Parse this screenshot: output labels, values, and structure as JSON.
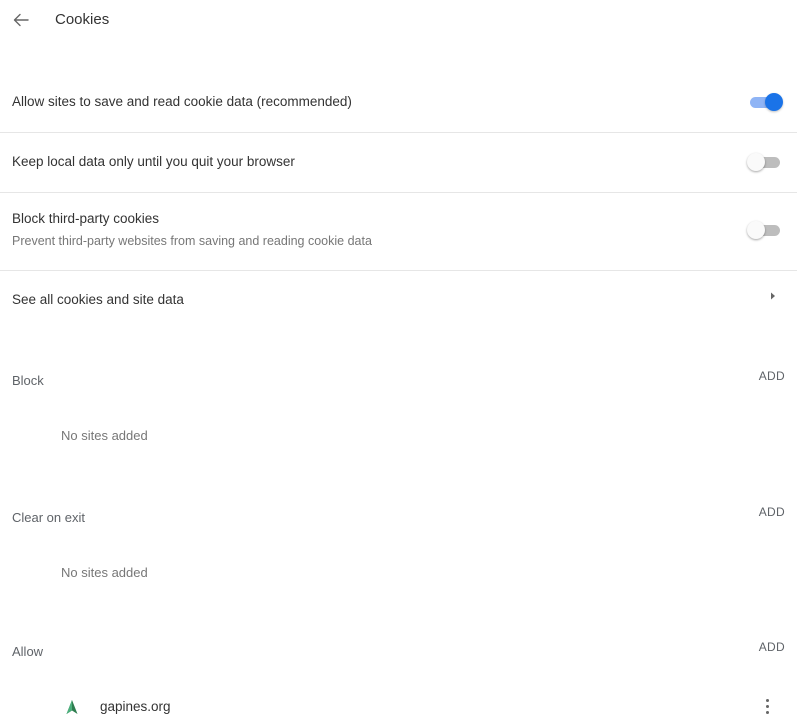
{
  "header": {
    "title": "Cookies",
    "back_icon": "arrow-back-icon"
  },
  "settings": [
    {
      "label": "Allow sites to save and read cookie data (recommended)",
      "enabled": true
    },
    {
      "label": "Keep local data only until you quit your browser",
      "enabled": false
    },
    {
      "label": "Block third-party cookies",
      "sublabel": "Prevent third-party websites from saving and reading cookie data",
      "enabled": false
    }
  ],
  "see_all": {
    "label": "See all cookies and site data",
    "icon": "chevron-right-icon"
  },
  "sections": {
    "block": {
      "title": "Block",
      "add_label": "ADD",
      "empty_text": "No sites added"
    },
    "clear_on_exit": {
      "title": "Clear on exit",
      "add_label": "ADD",
      "empty_text": "No sites added"
    },
    "allow": {
      "title": "Allow",
      "add_label": "ADD",
      "sites": [
        {
          "name": "gapines.org",
          "icon": "site-favicon-icon"
        }
      ]
    }
  },
  "colors": {
    "accent": "#1a73e8",
    "toggle_on_track": "#8fb4f5",
    "toggle_off_track": "#bdbdbd",
    "divider": "#e6e6e6",
    "favicon_green": "#2e7d4f"
  }
}
